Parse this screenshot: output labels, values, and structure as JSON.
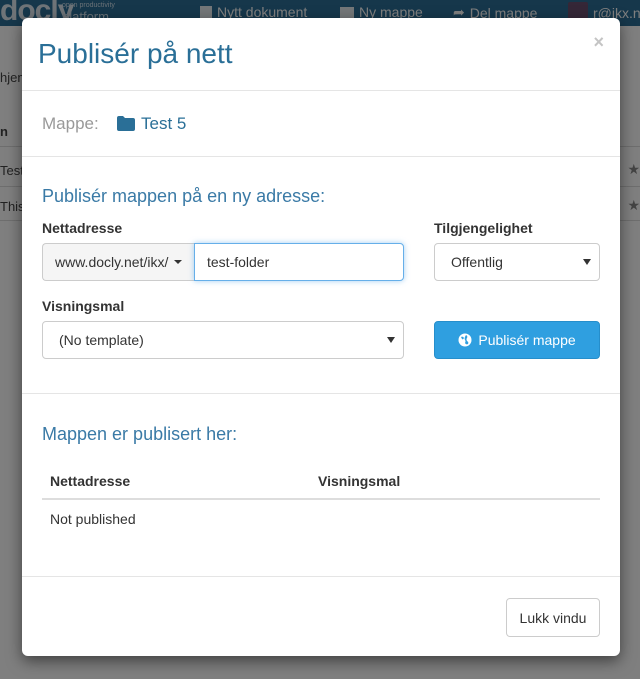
{
  "app": {
    "logo": "docly",
    "logo_tagline": "open productivity",
    "logo_sub": "platform",
    "nav": {
      "new_document": "Nytt dokument",
      "new_folder": "Ny mappe",
      "share_folder": "Del mappe",
      "user": "r@ikx.n"
    },
    "background": {
      "breadcrumb": "hjem",
      "col_header": "n",
      "row1": "Test",
      "row2": "This"
    }
  },
  "modal": {
    "title": "Publisér på nett",
    "close_symbol": "×",
    "folder_label": "Mappe:",
    "folder_name": "Test 5",
    "publish_section_title": "Publisér mappen på en ny adresse:",
    "address_label": "Nettadresse",
    "address_prefix": "www.docly.net/ikx/",
    "address_value": "test-folder",
    "availability_label": "Tilgjengelighet",
    "availability_value": "Offentlig",
    "template_label": "Visningsmal",
    "template_value": "(No template)",
    "publish_button": "Publisér mappe",
    "published_section_title": "Mappen er publisert her:",
    "table": {
      "headers": [
        "Nettadresse",
        "Visningsmal"
      ],
      "empty_text": "Not published"
    },
    "close_window_button": "Lukk vindu"
  },
  "colors": {
    "accent": "#2a6f97",
    "primary_button": "#2f9fe0",
    "topbar": "#2d6e96"
  }
}
